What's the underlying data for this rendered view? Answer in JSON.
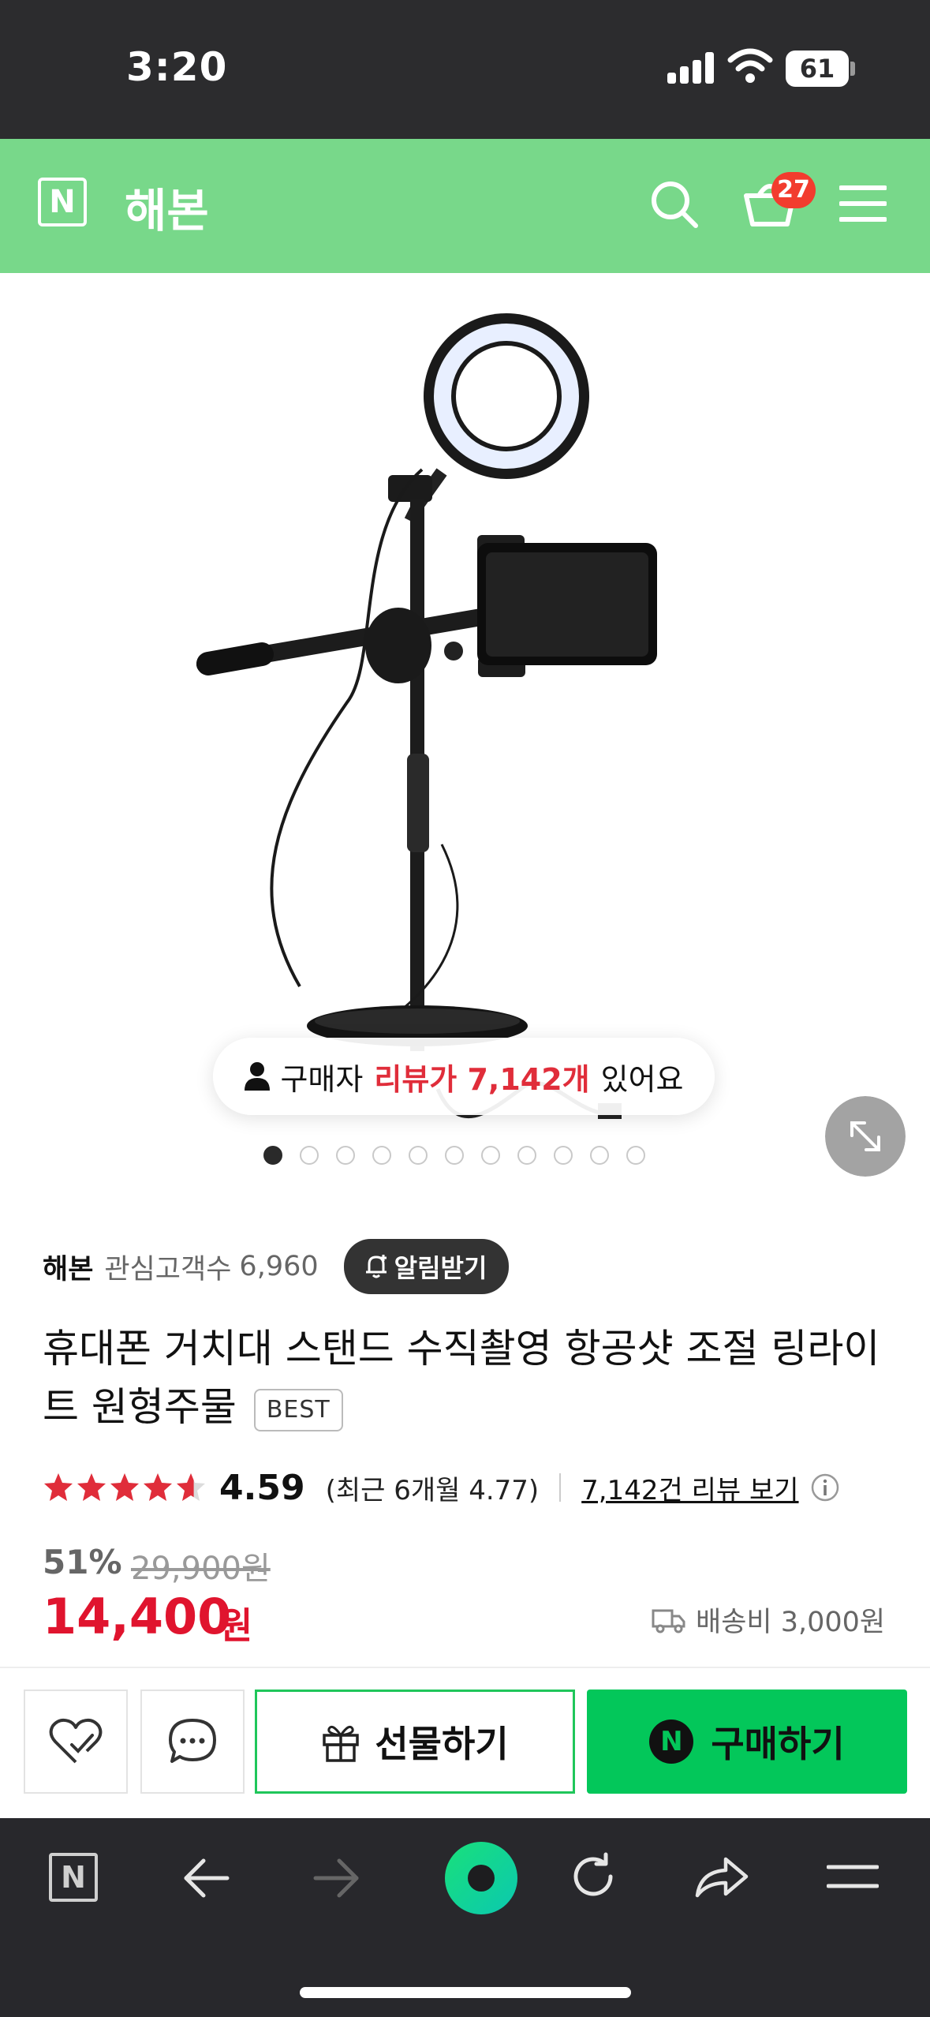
{
  "status_bar": {
    "time": "3:20",
    "battery": "61"
  },
  "header": {
    "logo": "N",
    "store_name": "해본",
    "cart_count": "27"
  },
  "gallery": {
    "review_prefix": "구매자",
    "review_highlight": "리뷰가 7,142개",
    "review_suffix": "있어요",
    "slide_count": 11,
    "active_slide": 1
  },
  "store": {
    "name": "해본",
    "interest_label": "관심고객수",
    "interest_count": "6,960",
    "alarm_label": "알림받기"
  },
  "product": {
    "title": "휴대폰 거치대 스탠드 수직촬영 항공샷 조절 링라이트 원형주물",
    "badge": "BEST"
  },
  "rating": {
    "stars": 4.59,
    "value": "4.59",
    "recent": "(최근 6개월 4.77)",
    "review_link": "7,142건 리뷰 보기"
  },
  "price": {
    "discount": "51%",
    "original": "29,900원",
    "sale": "14,400",
    "unit": "원",
    "shipping": "배송비 3,000원"
  },
  "actions": {
    "gift_label": "선물하기",
    "buy_label": "구매하기",
    "npay_logo": "N"
  },
  "browser": {
    "logo": "N"
  },
  "colors": {
    "header_green": "#78d88a",
    "naver_green": "#03c75a",
    "price_red": "#e0142e",
    "star_red": "#e02d3a"
  }
}
